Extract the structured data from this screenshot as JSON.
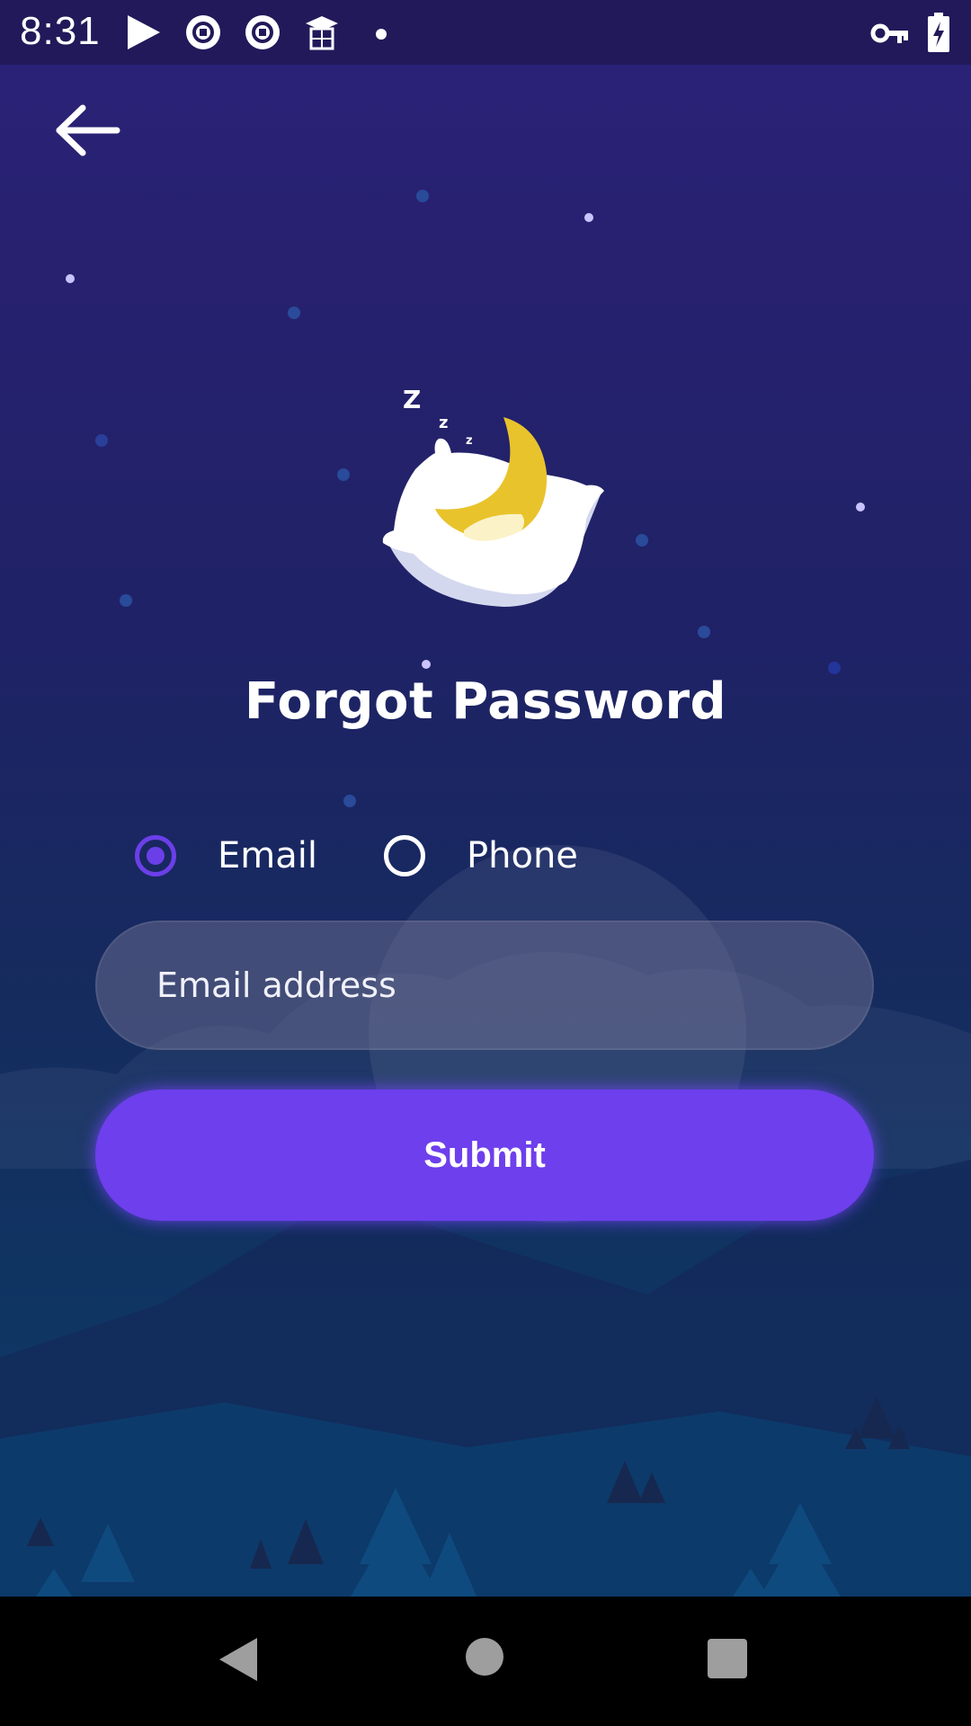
{
  "status_bar": {
    "time": "8:31",
    "left_icons": [
      "play-store-icon",
      "sync-app-icon",
      "sync-app-icon",
      "graduation-cap-icon",
      "notification-dot-icon"
    ],
    "right_icons": [
      "vpn-key-icon",
      "battery-charging-icon"
    ]
  },
  "header": {
    "back_icon": "arrow-left-icon"
  },
  "illustration": {
    "name": "sleeping-moon-pillow",
    "zzz": [
      "Z",
      "z",
      "z"
    ]
  },
  "page": {
    "title": "Forgot Password",
    "contact_method": {
      "options": [
        {
          "label": "Email",
          "selected": true
        },
        {
          "label": "Phone",
          "selected": false
        }
      ]
    },
    "email_input": {
      "placeholder": "Email address",
      "value": ""
    },
    "submit_label": "Submit"
  },
  "nav_bar": {
    "buttons": [
      "back-triangle-icon",
      "home-circle-icon",
      "recents-square-icon"
    ]
  },
  "colors": {
    "accent": "#6e3fed",
    "radio_selected": "#6b3fe8",
    "background_top": "#2b2279",
    "background_bottom": "#0d3a66",
    "moon_yellow": "#e9c32c"
  }
}
